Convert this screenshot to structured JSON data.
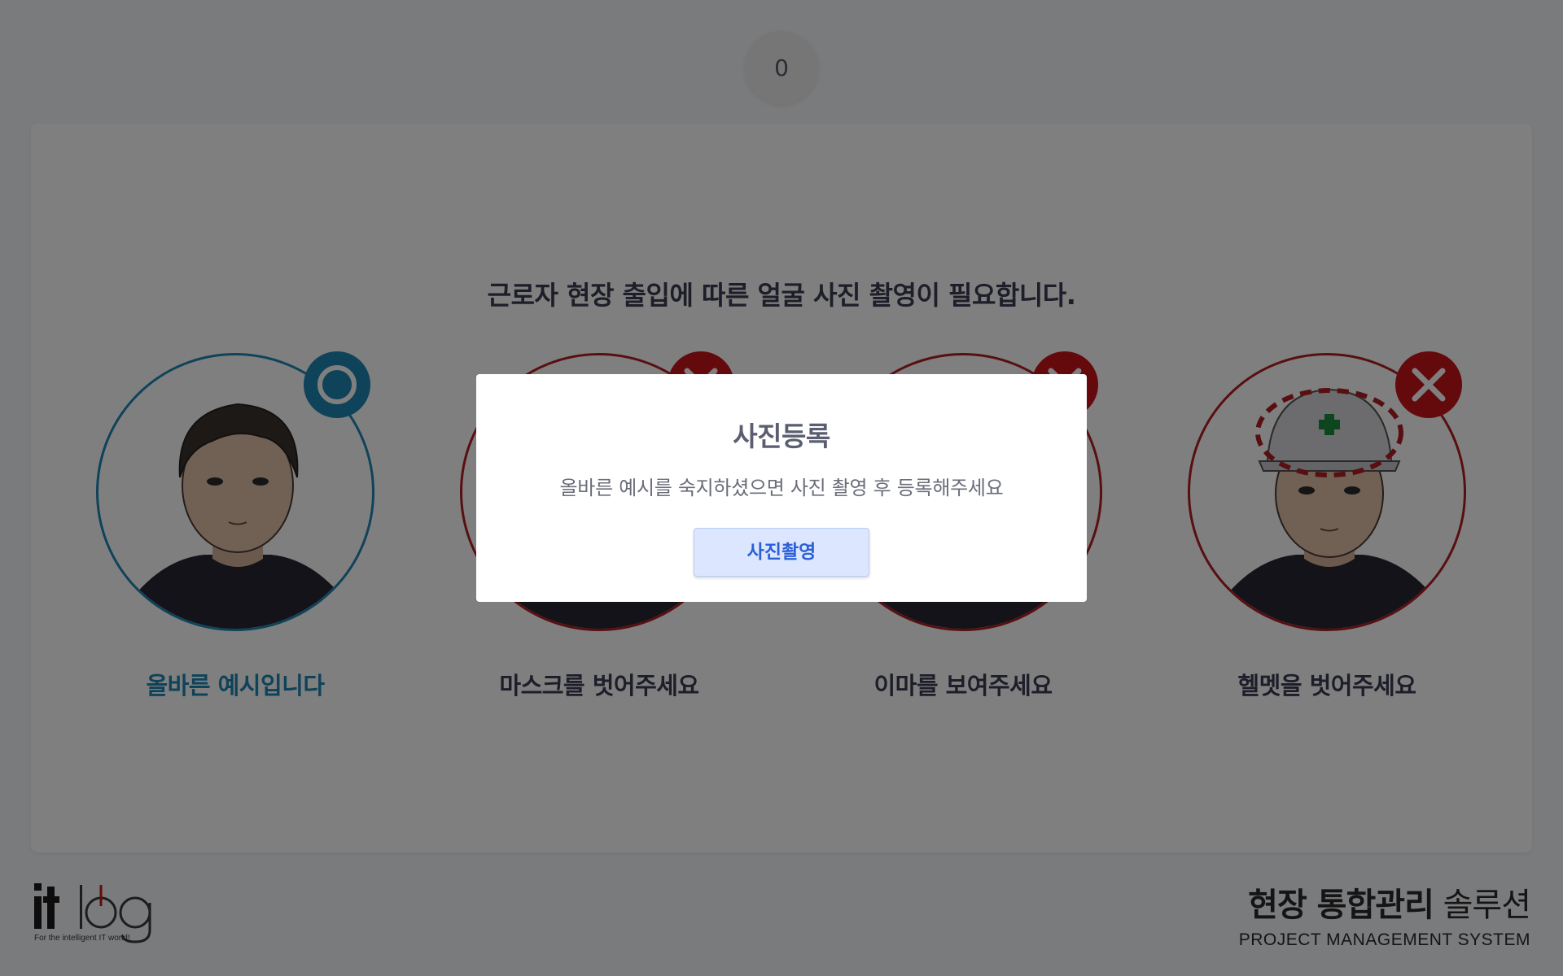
{
  "counter": {
    "value": "0"
  },
  "main": {
    "headline": "근로자 현장 출입에 따른 얼굴 사진 촬영이 필요합니다.",
    "examples": [
      {
        "label": "올바른 예시입니다",
        "status": "correct",
        "icon": "check-circle-icon",
        "color": "#1f86b3"
      },
      {
        "label": "마스크를 벗어주세요",
        "status": "wrong",
        "icon": "x-icon",
        "color": "#b11f22"
      },
      {
        "label": "이마를 보여주세요",
        "status": "wrong",
        "icon": "x-icon",
        "color": "#b11f22"
      },
      {
        "label": "헬멧을 벗어주세요",
        "status": "wrong",
        "icon": "x-icon",
        "color": "#b11f22"
      }
    ]
  },
  "footer": {
    "logo_text": "itlog",
    "logo_tagline": "For the intelligent IT world!",
    "brand_title_bold": "현장 통합관리",
    "brand_title_light": "솔루션",
    "brand_subtitle": "PROJECT MANAGEMENT SYSTEM"
  },
  "modal": {
    "title": "사진등록",
    "message": "올바른 예시를 숙지하셨으면 사진 촬영 후 등록해주세요",
    "button_label": "사진촬영"
  },
  "colors": {
    "correct": "#1f86b3",
    "wrong": "#b11f22",
    "button_bg": "#dce7ff",
    "button_text": "#2b5fd6"
  }
}
